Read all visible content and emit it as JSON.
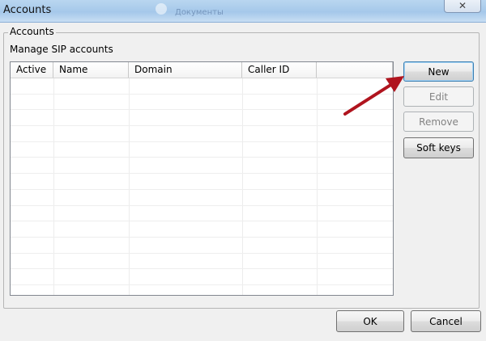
{
  "window": {
    "title": "Accounts",
    "background_text": "Документы"
  },
  "group": {
    "legend": "Accounts",
    "description": "Manage SIP accounts"
  },
  "list": {
    "columns": [
      "Active",
      "Name",
      "Domain",
      "Caller ID",
      ""
    ],
    "rows": []
  },
  "actions": {
    "new_label": "New",
    "edit_label": "Edit",
    "remove_label": "Remove",
    "softkeys_label": "Soft keys",
    "edit_enabled": false,
    "remove_enabled": false
  },
  "footer": {
    "ok_label": "OK",
    "cancel_label": "Cancel"
  },
  "annotation": {
    "color": "#b0141e"
  },
  "icons": {
    "close": "close-icon",
    "arrow": "red-arrow-annotation"
  }
}
